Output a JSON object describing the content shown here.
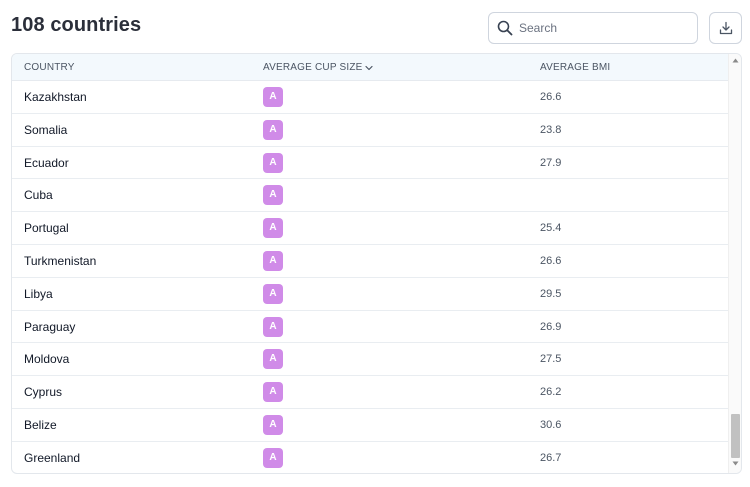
{
  "title": "108 countries",
  "search": {
    "placeholder": "Search",
    "value": ""
  },
  "table": {
    "columns": {
      "country": "COUNTRY",
      "cup": "AVERAGE CUP SIZE",
      "bmi": "AVERAGE BMI"
    },
    "sort": {
      "column": "AVERAGE CUP SIZE",
      "direction": "descending"
    },
    "rows": [
      {
        "country": "Kazakhstan",
        "cup": "A",
        "bmi": "26.6"
      },
      {
        "country": "Somalia",
        "cup": "A",
        "bmi": "23.8"
      },
      {
        "country": "Ecuador",
        "cup": "A",
        "bmi": "27.9"
      },
      {
        "country": "Cuba",
        "cup": "A",
        "bmi": ""
      },
      {
        "country": "Portugal",
        "cup": "A",
        "bmi": "25.4"
      },
      {
        "country": "Turkmenistan",
        "cup": "A",
        "bmi": "26.6"
      },
      {
        "country": "Libya",
        "cup": "A",
        "bmi": "29.5"
      },
      {
        "country": "Paraguay",
        "cup": "A",
        "bmi": "26.9"
      },
      {
        "country": "Moldova",
        "cup": "A",
        "bmi": "27.5"
      },
      {
        "country": "Cyprus",
        "cup": "A",
        "bmi": "26.2"
      },
      {
        "country": "Belize",
        "cup": "A",
        "bmi": "30.6"
      },
      {
        "country": "Greenland",
        "cup": "A",
        "bmi": "26.7"
      }
    ]
  },
  "colors": {
    "badge": "#d08be8",
    "header_bg": "#f3f9fd",
    "title": "#2b2f3a"
  },
  "icons": {
    "search": "search-icon",
    "download": "download-icon",
    "sort": "chevron-down-icon"
  }
}
